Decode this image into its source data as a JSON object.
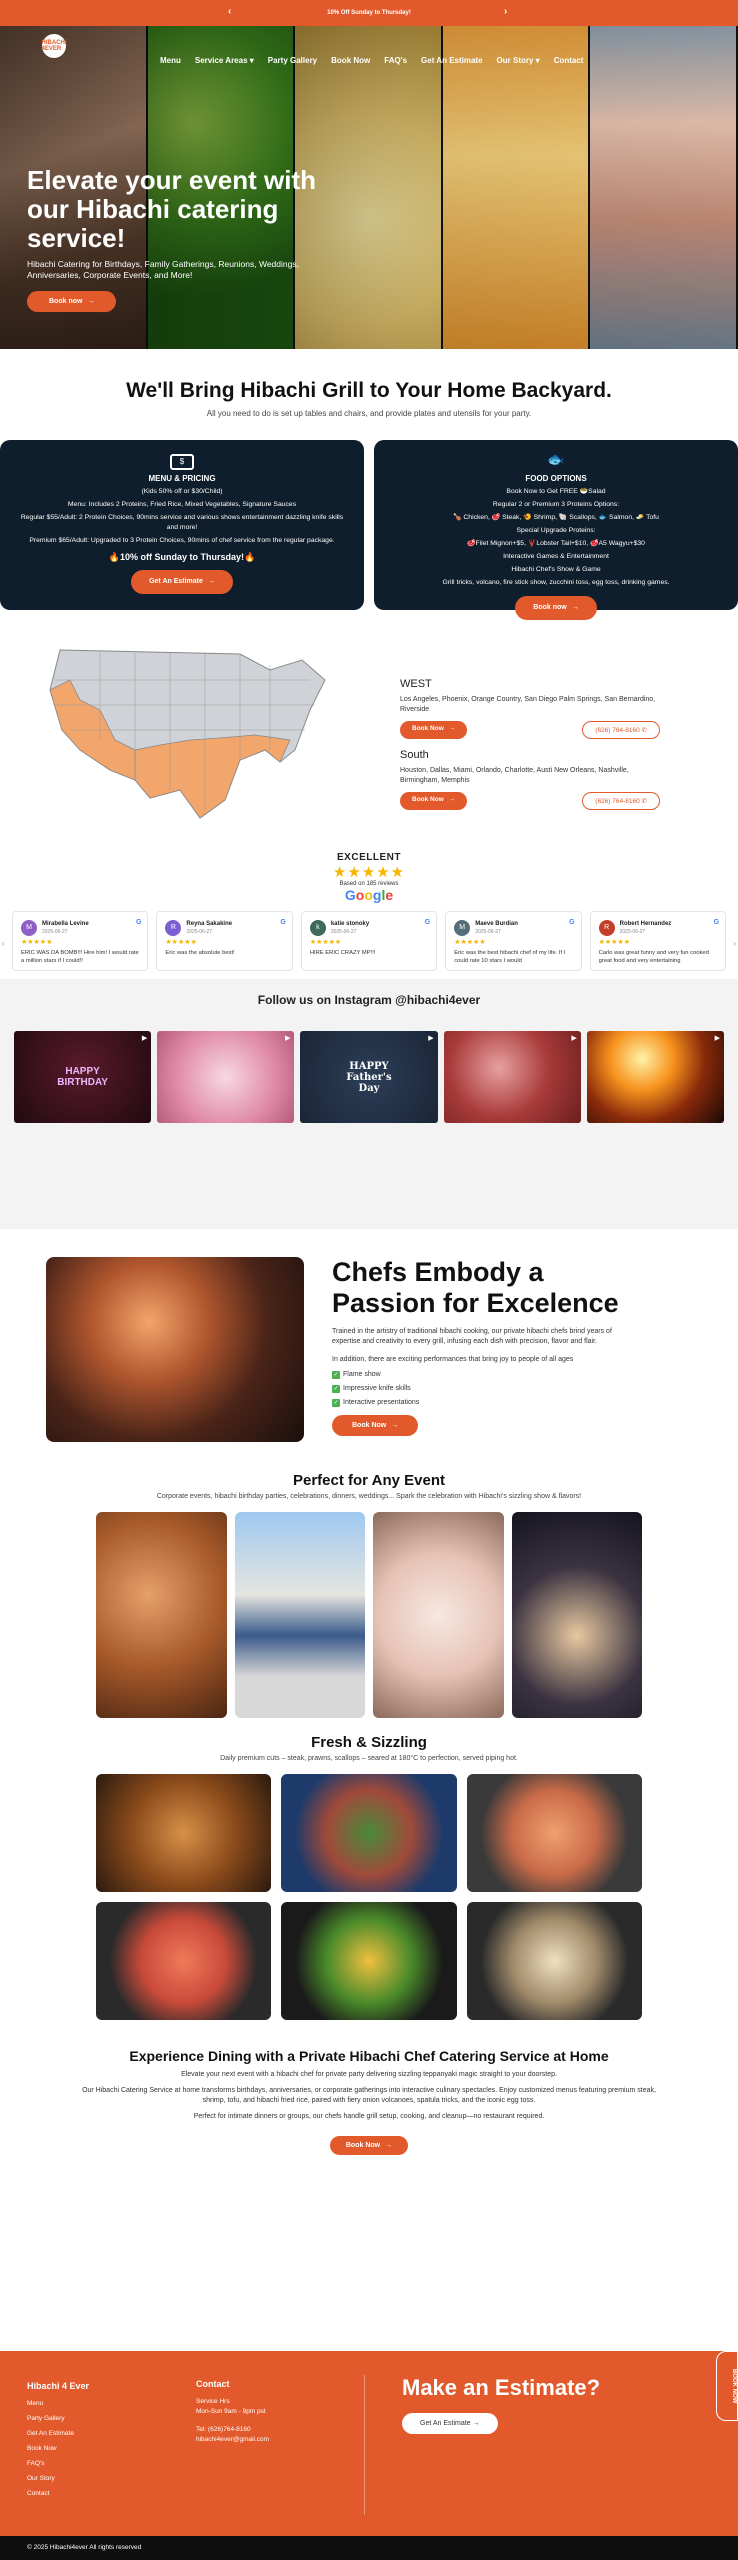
{
  "announcement": {
    "text": "10% Off Sunday to Thursday!",
    "prev": "‹",
    "next": "›"
  },
  "brand": {
    "logo": "HIBACHI 4EVER",
    "accent": "#e25a2c",
    "dark": "#0f1e2c"
  },
  "nav": [
    "Menu",
    "Service Areas ▾",
    "Party Gallery",
    "Book Now",
    "FAQ's",
    "Get An Estimate",
    "Our Story ▾",
    "Contact"
  ],
  "hero": {
    "title": "Elevate your event with our Hibachi catering service!",
    "subtitle": "Hibachi Catering for Birthdays, Family Gatherings, Reunions, Weddings, Anniversaries, Corporate Events, and More!",
    "cta": "Book now"
  },
  "intro": {
    "title": "We'll Bring Hibachi Grill to Your Home Backyard.",
    "subtitle": "All you need to do is set up tables and chairs, and provide plates and utensils for your party."
  },
  "menu_card": {
    "icon": "money-icon",
    "title": "MENU & PRICING",
    "line1": "(Kids 50% off or $30/Child)",
    "line2": "Menu: Includes 2 Proteins, Fried Rice, Mixed Vegetables, Signature Sauces",
    "line3": "Regular $55/Adult: 2 Protein Choices, 90mins service and various shows entertainment dazzling knife skills and more!",
    "line4": "Premium $65/Adult: Upgraded to 3 Protein Choices, 90mins of chef service from the regular package.",
    "highlight": "🔥10% off Sunday to Thursday!🔥",
    "cta": "Get An Estimate"
  },
  "food_card": {
    "icon": "fish-icon",
    "title": "FOOD OPTIONS",
    "line1": "Book Now to Get FREE 🥗Salad",
    "line2": "Regular 2 or Premium 3 Proteins Options:",
    "line3": "🍗 Chicken, 🥩 Steak, 🍤 Shrimp, 🐚 Scallops, 🐟 Salmon, 🧈 Tofu",
    "line4": "Special Upgrade Proteins:",
    "line5": "🥩Filet Mignon+$5, 🦞Lobster Tail+$10, 🥩A5 Wagyu+$30",
    "line6": "Interactive Games & Entertainment",
    "line7": "Hibachi Chef's Show & Game",
    "line8": "Grill tricks, volcano, fire stick show, zucchini toss, egg toss, drinking games.",
    "cta": "Book now"
  },
  "regions": [
    {
      "name": "WEST",
      "cities": "Los Angeles, Phoenix, Orange Country, San Diego Palm Springs, San Bernardino, Riverside",
      "cta": "Book Now",
      "phone": "(626) 764-8160"
    },
    {
      "name": "South",
      "cities": "Houston, Dallas, Miami, Orlando, Charlotte, Austi New Orleans, Nashville, Birmingham, Memphis",
      "cta": "Book Now",
      "phone": "(626) 764-8160"
    }
  ],
  "reviews": {
    "rating_word": "EXCELLENT",
    "stars": "★★★★★",
    "based": "Based on 185 reviews",
    "google": [
      "G",
      "o",
      "o",
      "g",
      "l",
      "e"
    ],
    "items": [
      {
        "initial": "M",
        "color": "#8e5fc4",
        "name": "Mirabella Levine",
        "date": "2025-06-27",
        "stars": "★★★★★",
        "text": "ERIC WAS DA BOMB!!! Hire him! I would rate a million stars if I could!!"
      },
      {
        "initial": "R",
        "color": "#7b5fd0",
        "name": "Reyna Sakakine",
        "date": "2025-06-27",
        "stars": "★★★★★",
        "text": "Eric was the absolute best!"
      },
      {
        "initial": "k",
        "color": "#3e6a5a",
        "name": "katie stonoky",
        "date": "2025-06-27",
        "stars": "★★★★★",
        "text": "HIRE ERIC CRAZY MP!!!"
      },
      {
        "initial": "M",
        "color": "#546e7a",
        "name": "Maeve Burdian",
        "date": "2025-06-27",
        "stars": "★★★★★",
        "text": "Eric was the best hibachi chef of my life. If I could rate 10 stars I would"
      },
      {
        "initial": "R",
        "color": "#c43f2a",
        "name": "Robert Hernandez",
        "date": "2025-06-27",
        "stars": "★★★★★",
        "text": "Carlo was great funny and very fun cooked great food and very entertaining"
      }
    ]
  },
  "instagram": {
    "title": "Follow us on Instagram @hibachi4ever",
    "posts": [
      "HAPPY BIRTHDAY",
      "",
      "HAPPY Father's Day",
      "",
      ""
    ]
  },
  "chefs": {
    "title": "Chefs Embody a Passion for Excelence",
    "p1": "Trained in the artistry of traditional hibachi cooking, our private hibachi chefs brind years of expertise and creativity to every grill, infusing each dish with precision, flavor and flair.",
    "p2": "In addition, there are exciting performances that bring joy to people of all ages",
    "features": [
      "Flame show",
      "Impressive knife skills",
      "Interactive presentations"
    ],
    "cta": "Book Now"
  },
  "events": {
    "title": "Perfect for Any Event",
    "subtitle": "Corporate events, hibachi birthday parties, celebrations, dinners, weddings... Spark the celebration with Hibachi's sizzling show & flavors!"
  },
  "fresh": {
    "title": "Fresh & Sizzling",
    "subtitle": "Daily premium cuts – steak, prawns, scallops – seared at 180°C to perfection, served piping hot."
  },
  "experience": {
    "title": "Experience Dining with a Private Hibachi Chef Catering Service at Home",
    "p1": "Elevate your next event with a hibachi chef for private party delivering sizzling teppanyaki magic straight to your doorstep.",
    "p2": "Our Hibachi Catering Service at home transforms birthdays, anniversaries, or corporate gatherings into interactive culinary spectacles. Enjoy customized menus featuring premium steak, shrimp, tofu, and hibachi fried rice, paired with fiery onion volcanoes, spatula tricks, and the iconic egg toss.",
    "p3": "Perfect for intimate dinners or groups, our chefs handle grill setup, cooking, and cleanup—no restaurant required.",
    "cta": "Book Now"
  },
  "footer": {
    "col1_title": "Hibachi 4 Ever",
    "col1_links": [
      "Menu",
      "Party Gallery",
      "Get An Estimate",
      "Book Now",
      "FAQ's",
      "Our Story",
      "Contact"
    ],
    "col2_title": "Contact",
    "hours_label": "Service Hrs",
    "hours": "Mon-Sun 9am - 9pm pst",
    "tel": "Tel: (626)764-8160",
    "email": "hibachi4ever@gmail.com",
    "estimate_title": "Make an Estimate?",
    "estimate_cta": "Get An Estimate",
    "side_tab": "BOOK NOW"
  },
  "copyright": "© 2025 Hibachi4ever All rights reserved"
}
